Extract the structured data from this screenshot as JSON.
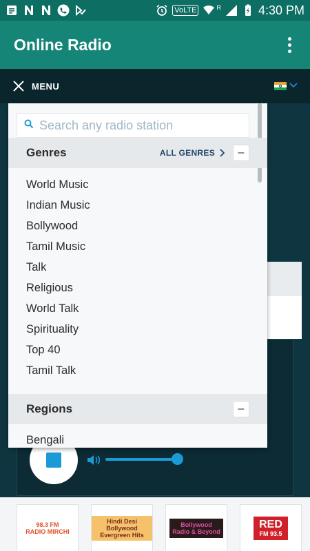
{
  "status_bar": {
    "time": "4:30 PM",
    "volte": "VoLTE",
    "signal_r": "R"
  },
  "app_bar": {
    "title": "Online Radio"
  },
  "menu_bar": {
    "label": "MENU"
  },
  "search": {
    "placeholder": "Search any radio station"
  },
  "genres": {
    "title": "Genres",
    "all_link": "ALL GENRES",
    "collapse": "–",
    "items": [
      "World Music",
      "Indian Music",
      "Bollywood",
      "Tamil Music",
      "Talk",
      "Religious",
      "World Talk",
      "Spirituality",
      "Top 40",
      "Tamil Talk"
    ]
  },
  "regions": {
    "title": "Regions",
    "collapse": "–",
    "items": [
      "Bengali"
    ]
  },
  "station_tiles": [
    {
      "line1": "98.3 FM",
      "line2": "RADIO MIRCHI"
    },
    {
      "line1": "Hindi Desi Bollywood",
      "line2": "Evergreen Hits"
    },
    {
      "line1": "Bollywood",
      "line2": "Radio & Beyond"
    },
    {
      "line1": "RED",
      "line2": "FM 93.5"
    }
  ],
  "colors": {
    "status_bar": "#0d6e63",
    "app_bar": "#158577",
    "menu_bar": "#0b252d",
    "accent": "#1a9bd6"
  }
}
